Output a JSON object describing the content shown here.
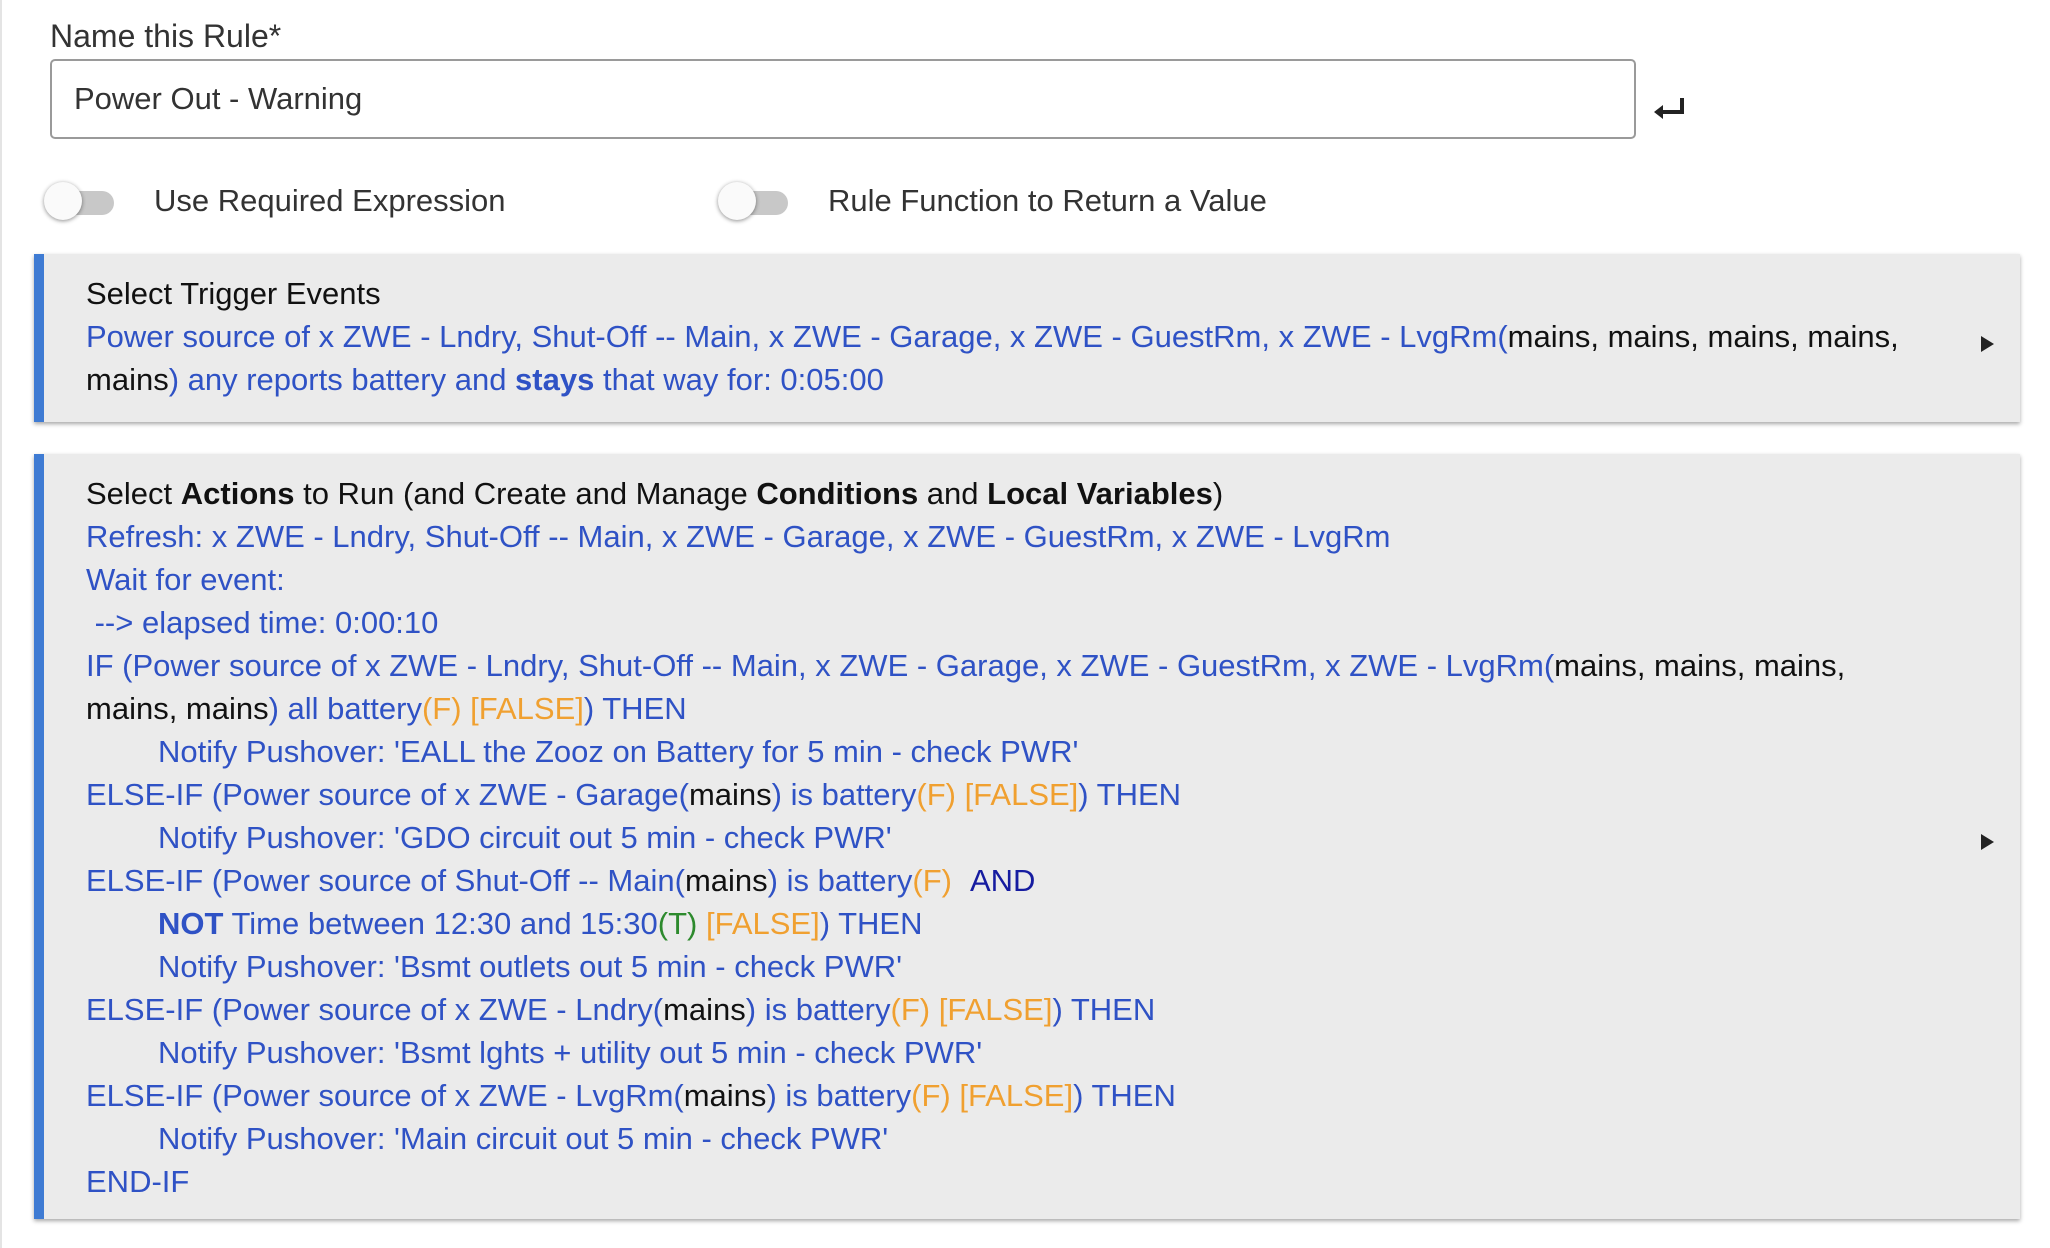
{
  "rule_name": {
    "label": "Name this Rule*",
    "value": "Power Out - Warning"
  },
  "toggles": {
    "required_expression": {
      "label": "Use Required Expression",
      "checked": false
    },
    "return_value": {
      "label": "Rule Function to Return a Value",
      "checked": false
    }
  },
  "trigger": {
    "title": "Select Trigger Events",
    "line1_blue": "Power source of x ZWE - Lndry, Shut-Off -- Main, x ZWE - Garage, x ZWE - GuestRm, x ZWE - LvgRm(",
    "line1_black": "mains, mains, mains, mains,",
    "line2_black": "mains",
    "line2_blue_a": ") any reports battery and ",
    "line2_bold": "stays",
    "line2_blue_b": " that way for: 0:05:00"
  },
  "actions": {
    "title_a": "Select ",
    "title_bold_a": "Actions",
    "title_b": " to Run (and Create and Manage ",
    "title_bold_b": "Conditions",
    "title_c": " and ",
    "title_bold_c": "Local Variables",
    "title_d": ")",
    "refresh": "Refresh: x ZWE - Lndry, Shut-Off -- Main, x ZWE - Garage, x ZWE - GuestRm, x ZWE - LvgRm",
    "wait": "Wait for event:",
    "elapsed": " --> elapsed time: 0:00:10",
    "if1_blue": "IF (Power source of x ZWE - Lndry, Shut-Off -- Main, x ZWE - Garage, x ZWE - GuestRm, x ZWE - LvgRm(",
    "if1_black": "mains, mains, mains,",
    "if1_line2_black": "mains, mains",
    "if1_line2_blue": ") all battery",
    "if1_line2_f": "(F) [FALSE]",
    "if1_line2_then": ") THEN",
    "notify1": "Notify Pushover: 'EALL the Zooz on Battery for 5 min - check PWR'",
    "elseif1_blue": "ELSE-IF (Power source of x ZWE - Garage(",
    "elseif1_black": "mains",
    "elseif1_blue2": ") is battery",
    "elseif1_f": "(F) [FALSE]",
    "elseif1_then": ") THEN",
    "notify2": "Notify Pushover: 'GDO circuit out 5 min - check PWR'",
    "elseif2_blue": "ELSE-IF (Power source of Shut-Off -- Main(",
    "elseif2_black": "mains",
    "elseif2_blue2": ") is battery",
    "elseif2_f": "(F)",
    "elseif2_and": "AND",
    "not_bold": "NOT",
    "not_text": " Time between 12:30 and 15:30",
    "not_t": "(T)",
    "not_false": "[FALSE]",
    "not_then": ") THEN",
    "notify3": "Notify Pushover: 'Bsmt outlets out 5 min - check PWR'",
    "elseif3_blue": "ELSE-IF (Power source of x ZWE - Lndry(",
    "elseif3_black": "mains",
    "elseif3_blue2": ") is battery",
    "elseif3_f": "(F) [FALSE]",
    "elseif3_then": ") THEN",
    "notify4": "Notify Pushover: 'Bsmt lghts + utility out 5 min - check PWR'",
    "elseif4_blue": "ELSE-IF (Power source of x ZWE - LvgRm(",
    "elseif4_black": "mains",
    "elseif4_blue2": ") is battery",
    "elseif4_f": "(F) [FALSE]",
    "elseif4_then": ") THEN",
    "notify5": "Notify Pushover: 'Main circuit out 5 min - check PWR'",
    "endif": "END-IF"
  }
}
